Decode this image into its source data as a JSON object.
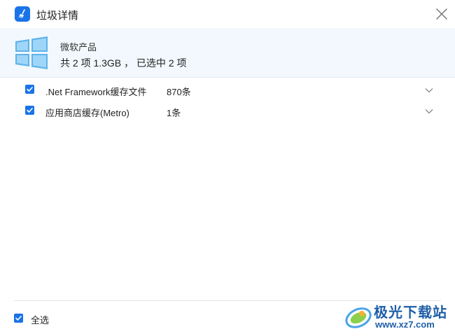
{
  "window": {
    "title": "垃圾详情",
    "close_icon": "close-icon",
    "app_icon": "broom-icon",
    "accent": "#1a73e8"
  },
  "header": {
    "logo_icon": "windows-logo-icon",
    "title": "微软产品",
    "summary": "共 2 项 1.3GB ， 已选中 2 项",
    "background": "#f2f8fd"
  },
  "items": [
    {
      "name": ".Net Framework缓存文件",
      "count": "870条",
      "checked": true
    },
    {
      "name": "应用商店缓存(Metro)",
      "count": "1条",
      "checked": true
    }
  ],
  "footer": {
    "select_all_label": "全选",
    "select_all_checked": true
  },
  "watermark": {
    "text_main": "极光下载站",
    "text_url": "www.xz7.com"
  }
}
